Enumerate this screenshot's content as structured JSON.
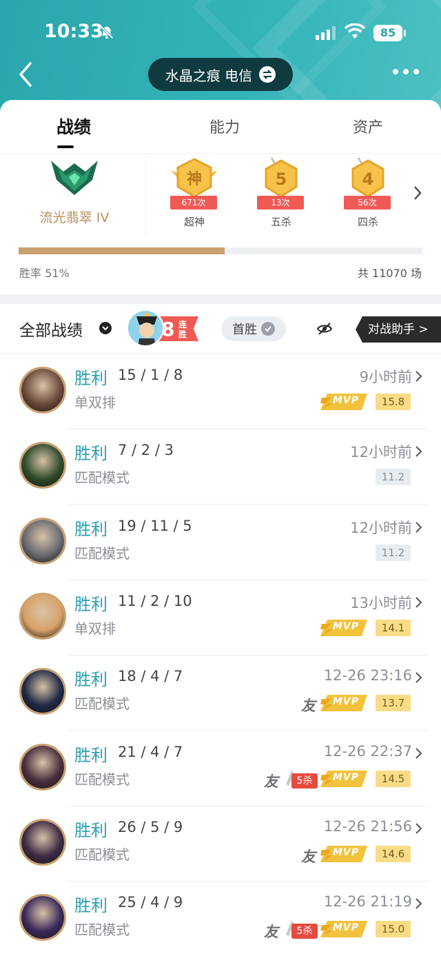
{
  "status_bar": {
    "time": "10:33",
    "battery": "85"
  },
  "header": {
    "server": "水晶之痕 电信"
  },
  "tabs": [
    {
      "label": "战绩",
      "active": true
    },
    {
      "label": "能力",
      "active": false
    },
    {
      "label": "资产",
      "active": false
    }
  ],
  "rank": {
    "name": "流光翡翠 IV"
  },
  "medals": [
    {
      "symbol": "神",
      "count": "671次",
      "label": "超神"
    },
    {
      "symbol": "5",
      "count": "13次",
      "label": "五杀"
    },
    {
      "symbol": "4",
      "count": "56次",
      "label": "四杀"
    }
  ],
  "stats": {
    "win_rate_label": "胜率 51%",
    "win_rate": 0.51,
    "total_games": "共 11070 场"
  },
  "filter": {
    "label": "全部战绩",
    "streak_num": "8",
    "streak_text": "连胜",
    "first_win": "首胜",
    "assistant": "对战助手 >"
  },
  "matches": [
    {
      "result": "胜利",
      "kda": "15 / 1 / 8",
      "mode": "单双排",
      "time": "9小时前",
      "mvp": true,
      "score": "15.8",
      "friend": false,
      "penta": false,
      "avatar_color": "#6b4a3a"
    },
    {
      "result": "胜利",
      "kda": "7 / 2 / 3",
      "mode": "匹配模式",
      "time": "12小时前",
      "mvp": false,
      "score": "11.2",
      "friend": false,
      "penta": false,
      "avatar_color": "#2f4a2a"
    },
    {
      "result": "胜利",
      "kda": "19 / 11 / 5",
      "mode": "匹配模式",
      "time": "12小时前",
      "mvp": false,
      "score": "11.2",
      "friend": false,
      "penta": false,
      "avatar_color": "#6a6b72"
    },
    {
      "result": "胜利",
      "kda": "11 / 2 / 10",
      "mode": "单双排",
      "time": "13小时前",
      "mvp": true,
      "score": "14.1",
      "friend": false,
      "penta": false,
      "avatar_color": "#d8a268"
    },
    {
      "result": "胜利",
      "kda": "18 / 4 / 7",
      "mode": "匹配模式",
      "time": "12-26 23:16",
      "mvp": true,
      "score": "13.7",
      "friend": true,
      "penta": false,
      "avatar_color": "#1f2a44"
    },
    {
      "result": "胜利",
      "kda": "21 / 4 / 7",
      "mode": "匹配模式",
      "time": "12-26 22:37",
      "mvp": true,
      "score": "14.5",
      "friend": true,
      "penta": true,
      "avatar_color": "#4a2f3e"
    },
    {
      "result": "胜利",
      "kda": "26 / 5 / 9",
      "mode": "匹配模式",
      "time": "12-26 21:56",
      "mvp": true,
      "score": "14.6",
      "friend": true,
      "penta": false,
      "avatar_color": "#3e2a44"
    },
    {
      "result": "胜利",
      "kda": "25 / 4 / 9",
      "mode": "匹配模式",
      "time": "12-26 21:19",
      "mvp": true,
      "score": "15.0",
      "friend": true,
      "penta": true,
      "avatar_color": "#3b2a5a"
    }
  ],
  "labels": {
    "friend": "友",
    "penta": "5杀",
    "mvp": "MVP"
  },
  "colors": {
    "accent": "#2b9fb2",
    "gold": "#c9a06f",
    "header": "#2aa6ad",
    "red": "#f05a55"
  }
}
